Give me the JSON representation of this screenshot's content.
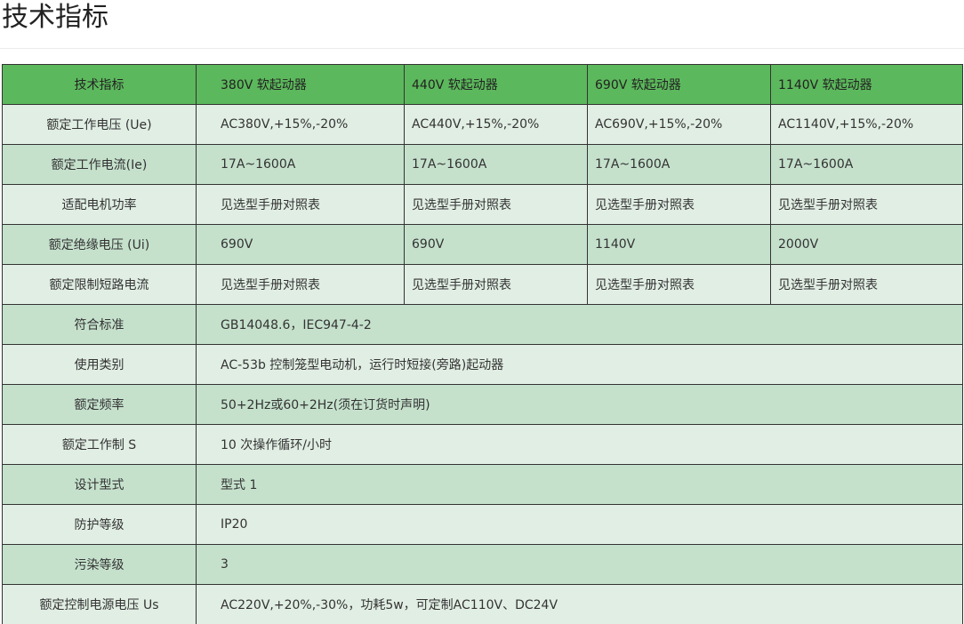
{
  "page_title": "技术指标",
  "colors": {
    "header_bg": "#5cb85c",
    "row_light": "#e1eee4",
    "row_dark": "#c5e1cc",
    "border": "#333333"
  },
  "table": {
    "header": [
      "技术指标",
      "380V 软起动器",
      "440V 软起动器",
      "690V 软起动器",
      "1140V 软起动器"
    ],
    "rows_multi": [
      {
        "label": "额定工作电压 (Ue)",
        "values": [
          "AC380V,+15%,-20%",
          "AC440V,+15%,-20%",
          "AC690V,+15%,-20%",
          "AC1140V,+15%,-20%"
        ]
      },
      {
        "label": "额定工作电流(Ie)",
        "values": [
          "17A~1600A",
          "17A~1600A",
          "17A~1600A",
          "17A~1600A"
        ]
      },
      {
        "label": "适配电机功率",
        "values": [
          "见选型手册对照表",
          "见选型手册对照表",
          "见选型手册对照表",
          "见选型手册对照表"
        ]
      },
      {
        "label": "额定绝缘电压 (Ui)",
        "values": [
          "690V",
          "690V",
          "1140V",
          "2000V"
        ]
      },
      {
        "label": "额定限制短路电流",
        "values": [
          "见选型手册对照表",
          "见选型手册对照表",
          "见选型手册对照表",
          "见选型手册对照表"
        ]
      }
    ],
    "rows_single": [
      {
        "label": "符合标准",
        "value": "GB14048.6，IEC947-4-2"
      },
      {
        "label": "使用类别",
        "value": "AC-53b 控制笼型电动机，运行时短接(旁路)起动器"
      },
      {
        "label": "额定频率",
        "value": "50+2Hz或60+2Hz(须在订货时声明)"
      },
      {
        "label": "额定工作制 S",
        "value": "10 次操作循环/小时"
      },
      {
        "label": "设计型式",
        "value": "型式 1"
      },
      {
        "label": "防护等级",
        "value": "IP20"
      },
      {
        "label": "污染等级",
        "value": "3"
      },
      {
        "label": "额定控制电源电压 Us",
        "value": "AC220V,+20%,-30%，功耗5w，可定制AC110V、DC24V"
      }
    ]
  }
}
